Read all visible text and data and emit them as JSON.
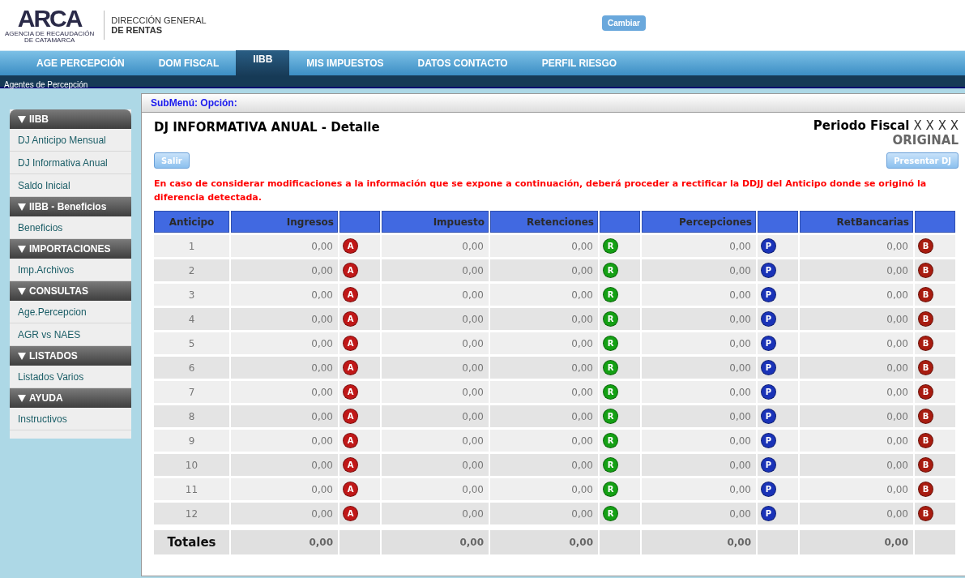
{
  "header": {
    "logo": {
      "mark": "ARCA",
      "agency_line_1": "AGENCIA DE RECAUDACIÓN",
      "agency_line_2": "DE CATAMARCA"
    },
    "org_line_1": "DIRECCIÓN GENERAL",
    "org_line_2": "DE RENTAS",
    "change_button": "Cambiar"
  },
  "tabs": [
    {
      "label": "AGE PERCEPCIÓN",
      "selected": false
    },
    {
      "label": "DOM FISCAL",
      "selected": false
    },
    {
      "label": "IIBB",
      "selected": true
    },
    {
      "label": "MIS IMPUESTOS",
      "selected": false
    },
    {
      "label": "DATOS CONTACTO",
      "selected": false
    },
    {
      "label": "PERFIL RIESGO",
      "selected": false
    }
  ],
  "breadcrumb": "Agentes de Percepción",
  "sidebar": {
    "sections": [
      {
        "title": "IIBB",
        "expanded": true,
        "items": [
          "DJ Anticipo Mensual",
          "DJ Informativa Anual",
          "Saldo Inicial"
        ]
      },
      {
        "title": "IIBB - Beneficios",
        "expanded": true,
        "items": [
          "Beneficios"
        ]
      },
      {
        "title": "IMPORTACIONES",
        "expanded": true,
        "items": [
          "Imp.Archivos"
        ]
      },
      {
        "title": "CONSULTAS",
        "expanded": true,
        "items": [
          "Age.Percepcion",
          "AGR vs NAES"
        ]
      },
      {
        "title": "LISTADOS",
        "expanded": true,
        "items": [
          "Listados Varios"
        ]
      },
      {
        "title": "AYUDA",
        "expanded": true,
        "items": [
          "Instructivos"
        ]
      }
    ]
  },
  "panel": {
    "submenu": "SubMenú: Opción:",
    "title": "DJ INFORMATIVA ANUAL - Detalle",
    "period_label": "Periodo Fiscal",
    "period_value": "X X X X",
    "status": "ORIGINAL",
    "exit_button": "Salir",
    "submit_button": "Presentar DJ",
    "warning": "En caso de considerar modificaciones a la información que se expone a continuación, deberá proceder a rectificar la DDJJ del Anticipo donde se originó la diferencia detectada."
  },
  "table": {
    "columns": [
      {
        "kind": "index",
        "label": "Anticipo"
      },
      {
        "kind": "amount",
        "label": "Ingresos"
      },
      {
        "kind": "badge",
        "color": "#c01818"
      },
      {
        "kind": "amount",
        "label": "Impuesto"
      },
      {
        "kind": "amount",
        "label": "Retenciones"
      },
      {
        "kind": "badge",
        "color": "#14a014"
      },
      {
        "kind": "amount",
        "label": "Percepciones"
      },
      {
        "kind": "badge",
        "color": "#1a33b8"
      },
      {
        "kind": "amount",
        "label": "RetBancarias"
      },
      {
        "kind": "badge",
        "color": "#a81c10"
      }
    ],
    "rows": [
      {
        "cells": [
          "1",
          "0,00",
          "A",
          "0,00",
          "0,00",
          "R",
          "0,00",
          "P",
          "0,00",
          "B"
        ]
      },
      {
        "cells": [
          "2",
          "0,00",
          "A",
          "0,00",
          "0,00",
          "R",
          "0,00",
          "P",
          "0,00",
          "B"
        ]
      },
      {
        "cells": [
          "3",
          "0,00",
          "A",
          "0,00",
          "0,00",
          "R",
          "0,00",
          "P",
          "0,00",
          "B"
        ]
      },
      {
        "cells": [
          "4",
          "0,00",
          "A",
          "0,00",
          "0,00",
          "R",
          "0,00",
          "P",
          "0,00",
          "B"
        ]
      },
      {
        "cells": [
          "5",
          "0,00",
          "A",
          "0,00",
          "0,00",
          "R",
          "0,00",
          "P",
          "0,00",
          "B"
        ]
      },
      {
        "cells": [
          "6",
          "0,00",
          "A",
          "0,00",
          "0,00",
          "R",
          "0,00",
          "P",
          "0,00",
          "B"
        ]
      },
      {
        "cells": [
          "7",
          "0,00",
          "A",
          "0,00",
          "0,00",
          "R",
          "0,00",
          "P",
          "0,00",
          "B"
        ]
      },
      {
        "cells": [
          "8",
          "0,00",
          "A",
          "0,00",
          "0,00",
          "R",
          "0,00",
          "P",
          "0,00",
          "B"
        ]
      },
      {
        "cells": [
          "9",
          "0,00",
          "A",
          "0,00",
          "0,00",
          "R",
          "0,00",
          "P",
          "0,00",
          "B"
        ]
      },
      {
        "cells": [
          "10",
          "0,00",
          "A",
          "0,00",
          "0,00",
          "R",
          "0,00",
          "P",
          "0,00",
          "B"
        ]
      },
      {
        "cells": [
          "11",
          "0,00",
          "A",
          "0,00",
          "0,00",
          "R",
          "0,00",
          "P",
          "0,00",
          "B"
        ]
      },
      {
        "cells": [
          "12",
          "0,00",
          "A",
          "0,00",
          "0,00",
          "R",
          "0,00",
          "P",
          "0,00",
          "B"
        ]
      }
    ],
    "totals": {
      "label": "Totales",
      "values": [
        "0,00",
        "0,00",
        "0,00",
        "0,00",
        "0,00"
      ]
    }
  }
}
